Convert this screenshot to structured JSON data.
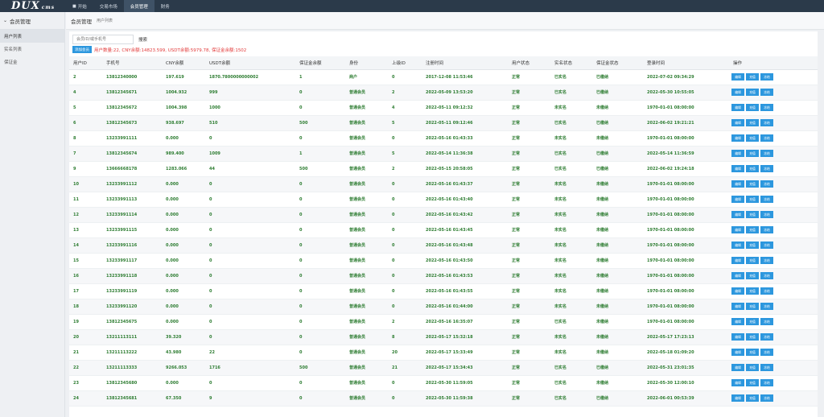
{
  "logo": {
    "main": "DUX",
    "sub": "cms"
  },
  "topnav": [
    {
      "icon": "■",
      "label": "开始"
    },
    {
      "label": "交易市场"
    },
    {
      "label": "会员管理"
    },
    {
      "label": "财务"
    }
  ],
  "sidebar": {
    "title": "会员管理",
    "items": [
      "用户列表",
      "实名列表",
      "保证金"
    ]
  },
  "crumb": {
    "title": "会员管理",
    "sub": "用户列表"
  },
  "search": {
    "placeholder": "会员ID/或手机号",
    "button": "搜索"
  },
  "actions": {
    "add_label": "添加会员",
    "stats": "用户数量:22, CNY余额:14823.599, USDT余额:5979.78, 保证金余额:1502"
  },
  "table": {
    "headers": [
      "用户ID",
      "手机号",
      "CNY余额",
      "USDT余额",
      "保证金余额",
      "身份",
      "上级ID",
      "注册时间",
      "用户状态",
      "实名状态",
      "保证金状态",
      "登录时间",
      "操作"
    ],
    "buttons": [
      "编辑",
      "充值",
      "冻结"
    ],
    "rows": [
      [
        "2",
        "13812340000",
        "197.619",
        "1870.7800000000002",
        "1",
        "商户",
        "0",
        "2017-12-08 11:53:46",
        "正常",
        "已实名",
        "已缴纳",
        "2022-07-02 09:34:29"
      ],
      [
        "4",
        "13812345671",
        "1004.932",
        "999",
        "0",
        "普通会员",
        "2",
        "2022-05-09 13:53:20",
        "正常",
        "已实名",
        "已缴纳",
        "2022-05-30 10:55:05"
      ],
      [
        "5",
        "13812345672",
        "1004.398",
        "1000",
        "0",
        "普通会员",
        "4",
        "2022-05-11 09:12:32",
        "正常",
        "未实名",
        "未缴纳",
        "1970-01-01 08:00:00"
      ],
      [
        "6",
        "13812345673",
        "938.697",
        "510",
        "500",
        "普通会员",
        "5",
        "2022-05-11 09:12:46",
        "正常",
        "已实名",
        "已缴纳",
        "2022-06-02 19:21:21"
      ],
      [
        "8",
        "13233991111",
        "0.000",
        "0",
        "0",
        "普通会员",
        "0",
        "2022-05-16 01:43:33",
        "正常",
        "未实名",
        "未缴纳",
        "1970-01-01 08:00:00"
      ],
      [
        "7",
        "13812345674",
        "989.400",
        "1009",
        "1",
        "普通会员",
        "5",
        "2022-05-14 11:36:38",
        "正常",
        "已实名",
        "已缴纳",
        "2022-05-14 11:36:59"
      ],
      [
        "9",
        "13666668178",
        "1283.066",
        "44",
        "500",
        "普通会员",
        "2",
        "2022-05-15 20:58:05",
        "正常",
        "已实名",
        "已缴纳",
        "2022-06-02 19:24:18"
      ],
      [
        "10",
        "13233991112",
        "0.000",
        "0",
        "0",
        "普通会员",
        "0",
        "2022-05-16 01:43:37",
        "正常",
        "未实名",
        "未缴纳",
        "1970-01-01 08:00:00"
      ],
      [
        "11",
        "13233991113",
        "0.000",
        "0",
        "0",
        "普通会员",
        "0",
        "2022-05-16 01:43:40",
        "正常",
        "未实名",
        "未缴纳",
        "1970-01-01 08:00:00"
      ],
      [
        "12",
        "13233991114",
        "0.000",
        "0",
        "0",
        "普通会员",
        "0",
        "2022-05-16 01:43:42",
        "正常",
        "未实名",
        "未缴纳",
        "1970-01-01 08:00:00"
      ],
      [
        "13",
        "13233991115",
        "0.000",
        "0",
        "0",
        "普通会员",
        "0",
        "2022-05-16 01:43:45",
        "正常",
        "未实名",
        "未缴纳",
        "1970-01-01 08:00:00"
      ],
      [
        "14",
        "13233991116",
        "0.000",
        "0",
        "0",
        "普通会员",
        "0",
        "2022-05-16 01:43:48",
        "正常",
        "未实名",
        "未缴纳",
        "1970-01-01 08:00:00"
      ],
      [
        "15",
        "13233991117",
        "0.000",
        "0",
        "0",
        "普通会员",
        "0",
        "2022-05-16 01:43:50",
        "正常",
        "未实名",
        "未缴纳",
        "1970-01-01 08:00:00"
      ],
      [
        "16",
        "13233991118",
        "0.000",
        "0",
        "0",
        "普通会员",
        "0",
        "2022-05-16 01:43:53",
        "正常",
        "未实名",
        "未缴纳",
        "1970-01-01 08:00:00"
      ],
      [
        "17",
        "13233991119",
        "0.000",
        "0",
        "0",
        "普通会员",
        "0",
        "2022-05-16 01:43:55",
        "正常",
        "未实名",
        "未缴纳",
        "1970-01-01 08:00:00"
      ],
      [
        "18",
        "13233991120",
        "0.000",
        "0",
        "0",
        "普通会员",
        "0",
        "2022-05-16 01:44:00",
        "正常",
        "未实名",
        "未缴纳",
        "1970-01-01 08:00:00"
      ],
      [
        "19",
        "13812345675",
        "0.000",
        "0",
        "0",
        "普通会员",
        "2",
        "2022-05-16 16:35:07",
        "正常",
        "已实名",
        "未缴纳",
        "1970-01-01 08:00:00"
      ],
      [
        "20",
        "13211113111",
        "39.320",
        "0",
        "0",
        "普通会员",
        "8",
        "2022-05-17 15:32:18",
        "正常",
        "未实名",
        "未缴纳",
        "2022-05-17 17:23:13"
      ],
      [
        "21",
        "13211113222",
        "43.980",
        "22",
        "0",
        "普通会员",
        "20",
        "2022-05-17 15:33:49",
        "正常",
        "未实名",
        "未缴纳",
        "2022-05-18 01:09:20"
      ],
      [
        "22",
        "13211113333",
        "9266.053",
        "1716",
        "500",
        "普通会员",
        "21",
        "2022-05-17 15:34:43",
        "正常",
        "已实名",
        "已缴纳",
        "2022-05-31 23:01:35"
      ],
      [
        "23",
        "13812345680",
        "0.000",
        "0",
        "0",
        "普通会员",
        "0",
        "2022-05-30 11:59:05",
        "正常",
        "已实名",
        "未缴纳",
        "2022-05-30 12:00:10"
      ],
      [
        "24",
        "13812345681",
        "67.350",
        "9",
        "0",
        "普通会员",
        "0",
        "2022-05-30 11:59:38",
        "正常",
        "已实名",
        "已缴纳",
        "2022-06-01 00:53:39"
      ]
    ]
  },
  "colors": {
    "topbar": "#2b3a4a",
    "accent": "#2c97de",
    "green_text": "#2e7d32",
    "stats_red": "#e23b3b"
  }
}
